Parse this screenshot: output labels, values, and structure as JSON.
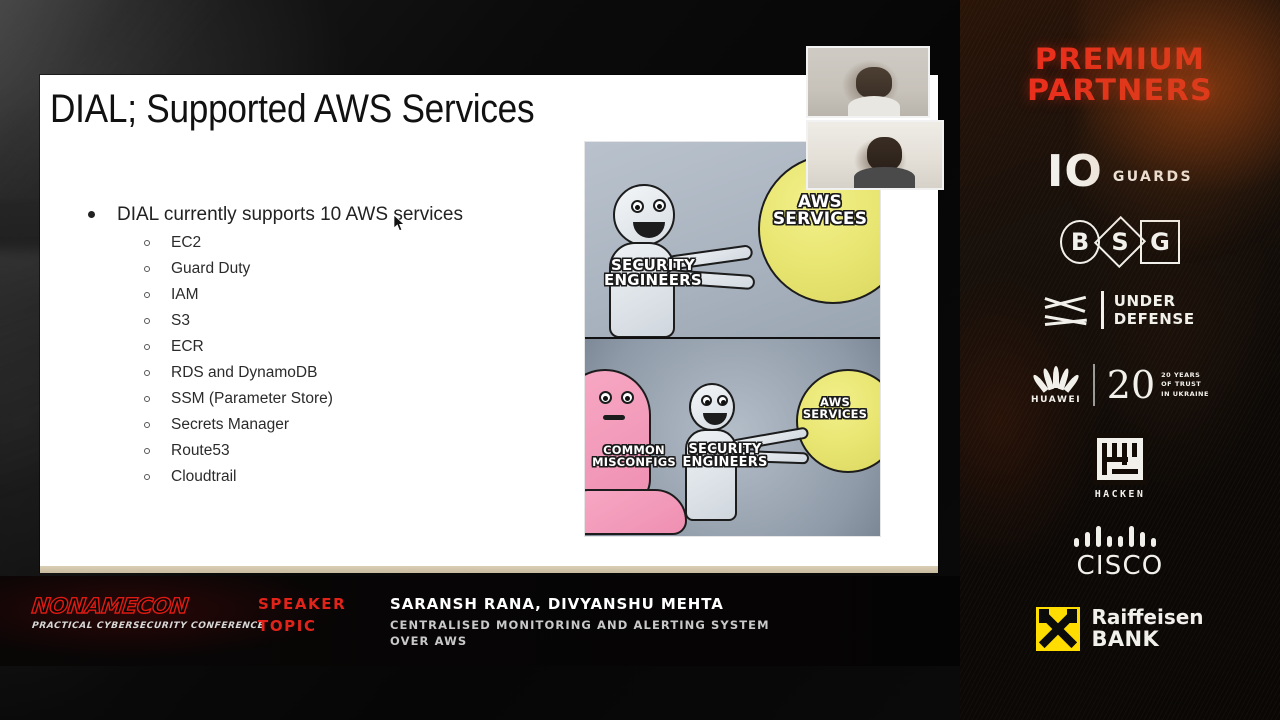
{
  "stream": {
    "slide": {
      "title": "DIAL; Supported AWS Services",
      "main_bullet": "DIAL currently supports 10 AWS services",
      "services": [
        "EC2",
        "Guard Duty",
        "IAM",
        "S3",
        "ECR",
        "RDS and DynamoDB",
        "SSM (Parameter Store)",
        "Secrets Manager",
        "Route53",
        "Cloudtrail"
      ],
      "meme": {
        "top_panel": {
          "balloon_label": "AWS SERVICES",
          "runner_label": "SECURITY ENGINEERS"
        },
        "bottom_panel": {
          "balloon_label": "AWS SERVICES",
          "runner_label": "SECURITY ENGINEERS",
          "grabber_label": "COMMON MISCONFIGS"
        }
      }
    },
    "webcams": [
      {
        "name": "speaker-cam-top"
      },
      {
        "name": "speaker-cam-bottom"
      }
    ]
  },
  "banner": {
    "brand": "NONAMECON",
    "tagline": "PRACTICAL CYBERSECURITY CONFERENCE",
    "speaker_label": "SPEAKER",
    "speaker_value": "SARANSH RANA, DIVYANSHU MEHTA",
    "topic_label": "TOPIC",
    "topic_value": "CENTRALISED MONITORING AND ALERTING SYSTEM OVER AWS"
  },
  "rail": {
    "title": "PREMIUM PARTNERS",
    "sponsors": [
      {
        "name": "io-guards",
        "mark": "IO",
        "word": "GUARDS"
      },
      {
        "name": "bsg",
        "b": "B",
        "s": "S",
        "g": "G"
      },
      {
        "name": "under-defense",
        "line1": "UNDER",
        "line2": "DEFENSE"
      },
      {
        "name": "huawei",
        "word": "HUAWEI",
        "anniv_number": "20",
        "anniv_line1": "20 YEARS",
        "anniv_line2": "OF TRUST",
        "anniv_line3": "IN UKRAINE"
      },
      {
        "name": "hacken",
        "word": "HACKEN"
      },
      {
        "name": "cisco",
        "word": "CISCO"
      },
      {
        "name": "raiffeisen",
        "line1": "Raiffeisen",
        "line2": "BANK"
      }
    ]
  },
  "colors": {
    "accent_red": "#e2231a",
    "partners_red": "#e8301c",
    "raiffeisen_yellow": "#ffdd00",
    "slide_bg": "#ffffff",
    "balloon_yellow": "#e9e673",
    "misconfig_pink": "#ef8fb2"
  }
}
